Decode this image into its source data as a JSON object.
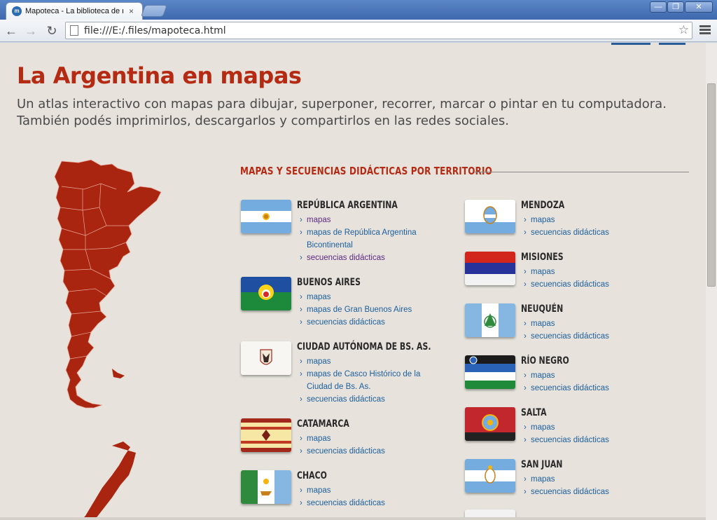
{
  "browser": {
    "tab_title": "Mapoteca - La biblioteca de r",
    "tab_favicon_text": "m",
    "tab_close": "×",
    "url": "file:///E:/.files/mapoteca.html",
    "window_buttons": {
      "minimize": "—",
      "maximize": "❐",
      "close": "✕"
    }
  },
  "page": {
    "title": "La Argentina en mapas",
    "subtitle": "Un atlas interactivo con mapas para dibujar, superponer, recorrer, marcar o pintar en tu computadora. También podés imprimirlos, descargarlos y compartirlos en las redes sociales.",
    "section_title": "MAPAS Y SECUENCIAS DIDÁCTICAS POR TERRITORIO"
  },
  "territories_left": [
    {
      "name": "REPÚBLICA ARGENTINA",
      "links": [
        {
          "text": "mapas",
          "visited": true
        },
        {
          "text": "mapas de República Argentina Bicontinental",
          "visited": false
        },
        {
          "text": "secuencias didácticas",
          "visited": true
        }
      ]
    },
    {
      "name": "BUENOS AIRES",
      "links": [
        {
          "text": "mapas",
          "visited": false
        },
        {
          "text": "mapas de Gran Buenos Aires",
          "visited": false
        },
        {
          "text": "secuencias didácticas",
          "visited": false
        }
      ]
    },
    {
      "name": "CIUDAD AUTÓNOMA DE BS. AS.",
      "links": [
        {
          "text": "mapas",
          "visited": false
        },
        {
          "text": "mapas de Casco Histórico de la Ciudad de Bs. As.",
          "visited": false
        },
        {
          "text": "secuencias didácticas",
          "visited": false
        }
      ]
    },
    {
      "name": "CATAMARCA",
      "links": [
        {
          "text": "mapas",
          "visited": false
        },
        {
          "text": "secuencias didácticas",
          "visited": false
        }
      ]
    },
    {
      "name": "CHACO",
      "links": [
        {
          "text": "mapas",
          "visited": false
        },
        {
          "text": "secuencias didácticas",
          "visited": false
        }
      ]
    }
  ],
  "territories_right": [
    {
      "name": "MENDOZA",
      "links": [
        {
          "text": "mapas",
          "visited": false
        },
        {
          "text": "secuencias didácticas",
          "visited": false
        }
      ]
    },
    {
      "name": "MISIONES",
      "links": [
        {
          "text": "mapas",
          "visited": false
        },
        {
          "text": "secuencias didácticas",
          "visited": false
        }
      ]
    },
    {
      "name": "NEUQUÉN",
      "links": [
        {
          "text": "mapas",
          "visited": false
        },
        {
          "text": "secuencias didácticas",
          "visited": false
        }
      ]
    },
    {
      "name": "RÍO NEGRO",
      "links": [
        {
          "text": "mapas",
          "visited": false
        },
        {
          "text": "secuencias didácticas",
          "visited": false
        }
      ]
    },
    {
      "name": "SALTA",
      "links": [
        {
          "text": "mapas",
          "visited": false
        },
        {
          "text": "secuencias didácticas",
          "visited": false
        }
      ]
    },
    {
      "name": "SAN JUAN",
      "links": [
        {
          "text": "mapas",
          "visited": false
        },
        {
          "text": "secuencias didácticas",
          "visited": false
        }
      ]
    }
  ],
  "colors": {
    "accent": "#b52a12",
    "link": "#1c5f9c",
    "visited_link": "#5b2a82",
    "background": "#e7e2dc"
  }
}
